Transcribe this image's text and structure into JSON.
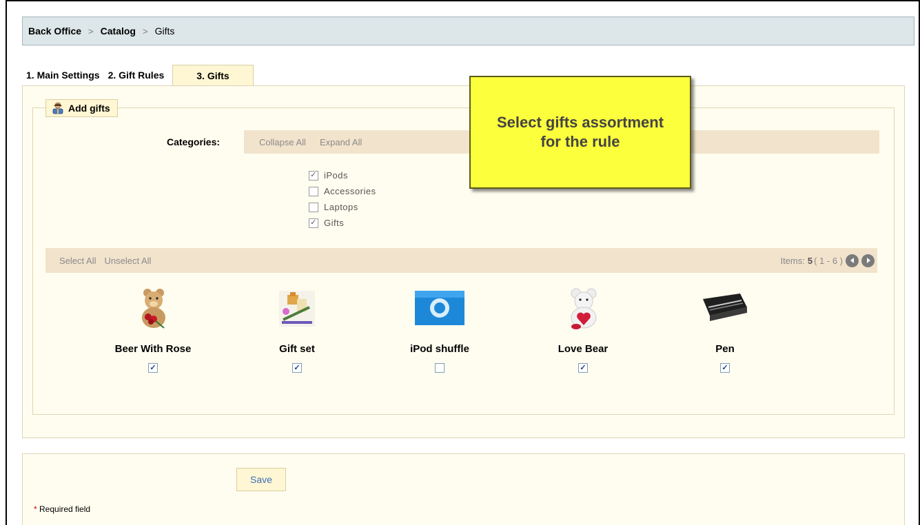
{
  "breadcrumb": {
    "items": [
      "Back Office",
      "Catalog",
      "Gifts"
    ],
    "separator": ">"
  },
  "tabs": [
    {
      "label": "1. Main Settings",
      "active": false
    },
    {
      "label": "2. Gift Rules",
      "active": false
    },
    {
      "label": "3. Gifts",
      "active": true
    }
  ],
  "fieldset": {
    "legend": "Add gifts",
    "legend_icon": "user-gift-icon"
  },
  "categories": {
    "label": "Categories:",
    "collapse_all": "Collapse All",
    "expand_all": "Expand All",
    "items": [
      {
        "label": "iPods",
        "checked": true
      },
      {
        "label": "Accessories",
        "checked": false
      },
      {
        "label": "Laptops",
        "checked": false
      },
      {
        "label": "Gifts",
        "checked": true
      }
    ]
  },
  "selection": {
    "select_all": "Select All",
    "unselect_all": "Unselect All",
    "items_label": "Items:",
    "items_count": "5",
    "items_range": "( 1 - 6 )",
    "prev_icon": "prev-circle-icon",
    "next_icon": "next-circle-icon"
  },
  "products": [
    {
      "name": "Beer With Rose",
      "checked": true,
      "icon": "teddy-bear-rose-icon"
    },
    {
      "name": "Gift set",
      "checked": true,
      "icon": "gift-set-icon"
    },
    {
      "name": "iPod shuffle",
      "checked": false,
      "icon": "ipod-shuffle-icon"
    },
    {
      "name": "Love Bear",
      "checked": true,
      "icon": "love-bear-icon"
    },
    {
      "name": "Pen",
      "checked": true,
      "icon": "pen-case-icon"
    }
  ],
  "tooltip": {
    "text": "Select gifts assortment for the rule"
  },
  "form": {
    "save_label": "Save",
    "required_star": "*",
    "required_label": "Required field"
  },
  "colors": {
    "tooltip_bg": "#fcff3c",
    "panel_bg": "#fffdf0",
    "bar_bg": "#f2e3cc",
    "breadcrumb_bg": "#dde6e9"
  }
}
